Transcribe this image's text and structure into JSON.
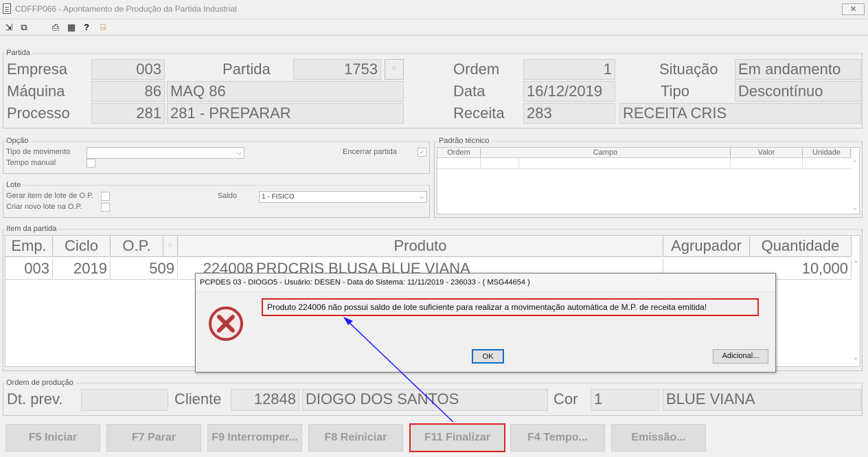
{
  "window": {
    "title": "CDFFP066 - Apontamento de Produção da Partida Industrial",
    "close": "✕"
  },
  "toolbar": {
    "icons": [
      "exit-icon",
      "window-icon",
      "print-icon",
      "grid-icon",
      "help-icon",
      "door-icon"
    ]
  },
  "partida": {
    "group": "Partida",
    "empresa_label": "Empresa",
    "empresa": "003",
    "partida_label": "Partida",
    "partida": "1753",
    "ordem_label": "Ordem",
    "ordem": "1",
    "situacao_label": "Situação",
    "situacao": "Em andamento",
    "maquina_label": "Máquina",
    "maquina_code": "86",
    "maquina_desc": "MAQ 86",
    "data_label": "Data",
    "data": "16/12/2019",
    "tipo_label": "Tipo",
    "tipo": "Descontínuo",
    "processo_label": "Processo",
    "processo_code": "281",
    "processo_desc": "281 - PREPARAR",
    "receita_label": "Receita",
    "receita_code": "283",
    "receita_desc": "RECEITA CRIS"
  },
  "opcao": {
    "group": "Opção",
    "tipo_mov_label": "Tipo de movimento",
    "tipo_mov_value": "",
    "tempo_manual_label": "Tempo manual",
    "encerrar_label": "Encerrar partida"
  },
  "lote": {
    "group": "Lote",
    "gerar_label": "Gerar item de lote de O.P.",
    "criar_label": "Criar novo lote na O.P.",
    "saldo_label": "Saldo",
    "saldo_value": "1 - FISICO"
  },
  "padrao": {
    "group": "Padrão técnico",
    "columns": [
      "Ordem",
      "Campo",
      "Valor",
      "Unidade"
    ]
  },
  "item": {
    "group": "Item da partida",
    "columns": [
      "Emp.",
      "Ciclo",
      "O.P.",
      "",
      "Produto",
      "Agrupador",
      "Quantidade"
    ],
    "rows": [
      {
        "emp": "003",
        "ciclo": "2019",
        "op": "509",
        "codigo": "224008",
        "produto": "PRDCRIS BLUSA BLUE VIANA",
        "agrupador": "",
        "quantidade": "10,000"
      }
    ]
  },
  "ordem_producao": {
    "group": "Ordem de produção",
    "dtprev_label": "Dt. prev.",
    "dtprev": "",
    "cliente_label": "Cliente",
    "cliente_code": "12848",
    "cliente_name": "DIOGO DOS SANTOS",
    "cor_label": "Cor",
    "cor_code": "1",
    "cor_name": "BLUE VIANA"
  },
  "buttons": [
    "F5 Iniciar",
    "F7 Parar",
    "F9 Interromper...",
    "F8 Reiniciar",
    "F11 Finalizar",
    "F4 Tempo...",
    "Emissão..."
  ],
  "dialog": {
    "title": "PCPDES 03 - DIOGO5 - Usuário: DESEN - Data do Sistema: 11/11/2019 - 236033 - ( MSG44654 )",
    "message": "Produto 224006 não possui saldo de lote suficiente para realizar a movimentação automática de M.P. de receita emitida!",
    "ok": "OK",
    "adicional": "Adicional..."
  },
  "colors": {
    "highlight": "#e02020",
    "arrow": "#1a1aff",
    "error": "#c62828"
  }
}
